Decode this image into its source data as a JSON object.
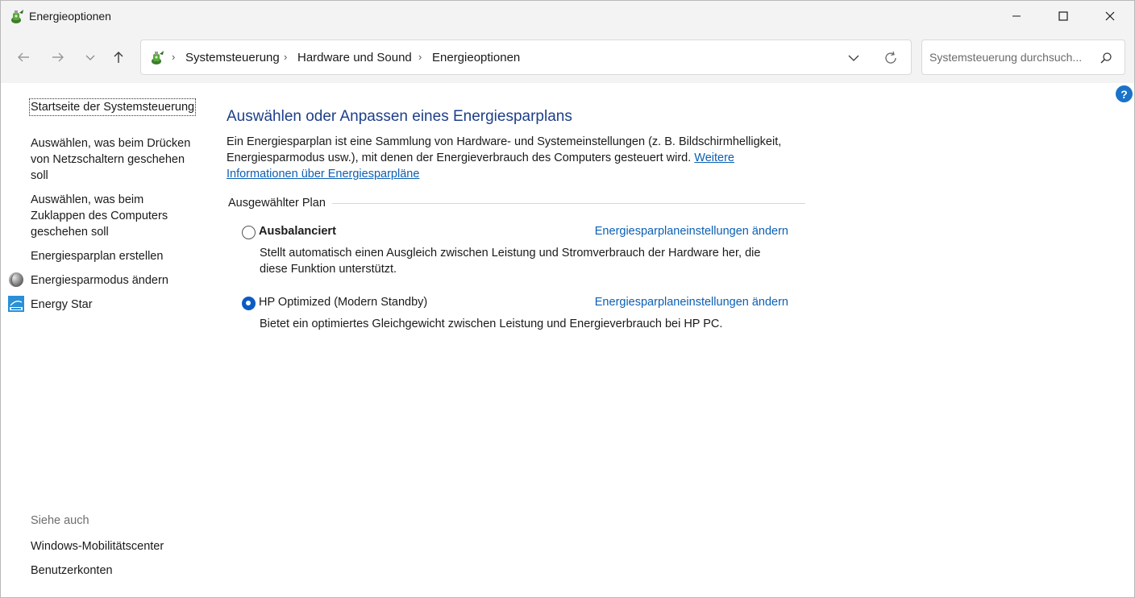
{
  "window": {
    "title": "Energieoptionen",
    "controls": {
      "minimize": "minimize",
      "maximize": "maximize",
      "close": "close"
    }
  },
  "address": {
    "crumbs": [
      "Systemsteuerung",
      "Hardware und Sound",
      "Energieoptionen"
    ]
  },
  "search": {
    "placeholder": "Systemsteuerung durchsuch..."
  },
  "help": {
    "label": "?"
  },
  "sidebar": {
    "home": "Startseite der Systemsteuerung",
    "tasks": [
      "Auswählen, was beim Drücken von Netzschaltern geschehen soll",
      "Auswählen, was beim Zuklappen des Computers geschehen soll",
      "Energiesparplan erstellen",
      "Energiesparmodus ändern",
      "Energy Star"
    ],
    "see_also_label": "Siehe auch",
    "see_also": [
      "Windows-Mobilitätscenter",
      "Benutzerkonten"
    ]
  },
  "main": {
    "title": "Auswählen oder Anpassen eines Energiesparplans",
    "description": "Ein Energiesparplan ist eine Sammlung von Hardware- und Systemeinstellungen (z. B. Bildschirmhelligkeit, Energiesparmodus usw.), mit denen der Energieverbrauch des Computers gesteuert wird.",
    "more_info_link": "Weitere Informationen über Energiesparpläne",
    "group_label": "Ausgewählter Plan",
    "plans": [
      {
        "name": "Ausbalanciert",
        "selected": false,
        "change_link": "Energiesparplaneinstellungen ändern",
        "description": "Stellt automatisch einen Ausgleich zwischen Leistung und Stromverbrauch der Hardware her, die diese Funktion unterstützt."
      },
      {
        "name": "HP Optimized (Modern Standby)",
        "selected": true,
        "change_link": "Energiesparplaneinstellungen ändern",
        "description": "Bietet ein optimiertes Gleichgewicht zwischen Leistung und Energieverbrauch bei HP PC."
      }
    ]
  },
  "colors": {
    "title_blue": "#1e3f8a",
    "link_blue": "#0b5fb4",
    "radio_selected": "#0b5cc4",
    "chrome_bg": "#f3f3f3"
  },
  "icons": {
    "app": "power-options-icon",
    "sleep_mode": "moon-globe-icon",
    "energy_star": "energy-star-icon"
  }
}
